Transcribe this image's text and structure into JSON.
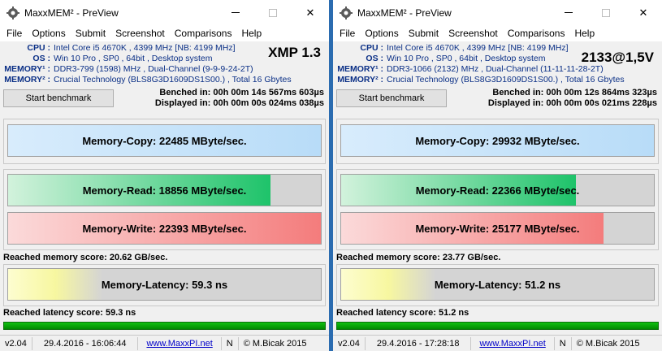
{
  "windows": [
    {
      "title": "MaxxMEM² - PreView",
      "menu": [
        "File",
        "Options",
        "Submit",
        "Screenshot",
        "Comparisons",
        "Help"
      ],
      "info": [
        {
          "label": "CPU :",
          "value": "Intel Core i5 4670K , 4399 MHz  [NB: 4199 MHz]"
        },
        {
          "label": "OS :",
          "value": "Win 10 Pro , SP0 , 64bit , Desktop system"
        },
        {
          "label": "MEMORY¹ :",
          "value": "DDR3-799 (1598) MHz , Dual-Channel (9-9-9-24-2T)"
        },
        {
          "label": "MEMORY² :",
          "value": "Crucial Technology (BLS8G3D1609DS1S00.) , Total 16 Gbytes"
        }
      ],
      "tag": "XMP 1.3",
      "start_button": "Start benchmark",
      "benched": "Benched in: 00h 00m 14s 567ms 603µs",
      "displayed": "Displayed in: 00h 00m 00s 024ms 038µs",
      "copy": {
        "text": "Memory-Copy: 22485 MByte/sec.",
        "fill": 1.0
      },
      "read": {
        "text": "Memory-Read: 18856 MByte/sec.",
        "fill": 0.84
      },
      "write": {
        "text": "Memory-Write: 22393 MByte/sec.",
        "fill": 1.0
      },
      "mem_score": "Reached memory score: 20.62 GB/sec.",
      "latency": {
        "text": "Memory-Latency: 59.3 ns",
        "fill": 0.3
      },
      "lat_score": "Reached latency score: 59.3 ns",
      "status": {
        "version": "v2.04",
        "date": "29.4.2016 - 16:06:44",
        "link": "www.MaxxPI.net",
        "n": "N",
        "copy": "© M.Bicak 2015"
      }
    },
    {
      "title": "MaxxMEM² - PreView",
      "menu": [
        "File",
        "Options",
        "Submit",
        "Screenshot",
        "Comparisons",
        "Help"
      ],
      "info": [
        {
          "label": "CPU :",
          "value": "Intel Core i5 4670K , 4399 MHz  [NB: 4199 MHz]"
        },
        {
          "label": "OS :",
          "value": "Win 10 Pro , SP0 , 64bit , Desktop system"
        },
        {
          "label": "MEMORY¹ :",
          "value": "DDR3-1066 (2132) MHz , Dual-Channel (11-11-11-28-2T)"
        },
        {
          "label": "MEMORY² :",
          "value": "Crucial Technology (BLS8G3D1609DS1S00.) , Total 16 Gbytes"
        }
      ],
      "tag": "2133@1,5V",
      "start_button": "Start benchmark",
      "benched": "Benched in: 00h 00m 12s 864ms 323µs",
      "displayed": "Displayed in: 00h 00m 00s 021ms 228µs",
      "copy": {
        "text": "Memory-Copy: 29932 MByte/sec.",
        "fill": 1.0
      },
      "read": {
        "text": "Memory-Read: 22366 MByte/sec.",
        "fill": 0.75
      },
      "write": {
        "text": "Memory-Write: 25177 MByte/sec.",
        "fill": 0.84
      },
      "mem_score": "Reached memory score: 23.77 GB/sec.",
      "latency": {
        "text": "Memory-Latency: 51.2 ns",
        "fill": 0.3
      },
      "lat_score": "Reached latency score: 51.2 ns",
      "status": {
        "version": "v2.04",
        "date": "29.4.2016 - 17:28:18",
        "link": "www.MaxxPI.net",
        "n": "N",
        "copy": "© M.Bicak 2015"
      }
    }
  ],
  "colors": {
    "copy_fill": "#b8dcf8",
    "read_fill": "#1ec36a",
    "write_fill": "#f47c7c",
    "latency_fill": "#f7f7a0",
    "label_blue": "#0a2f86",
    "divider": "#2b6cb0"
  },
  "icons": {
    "app": "maxxmem-gear-icon",
    "close": "close-icon",
    "maximize": "maximize-icon",
    "minimize": "minimize-icon"
  }
}
